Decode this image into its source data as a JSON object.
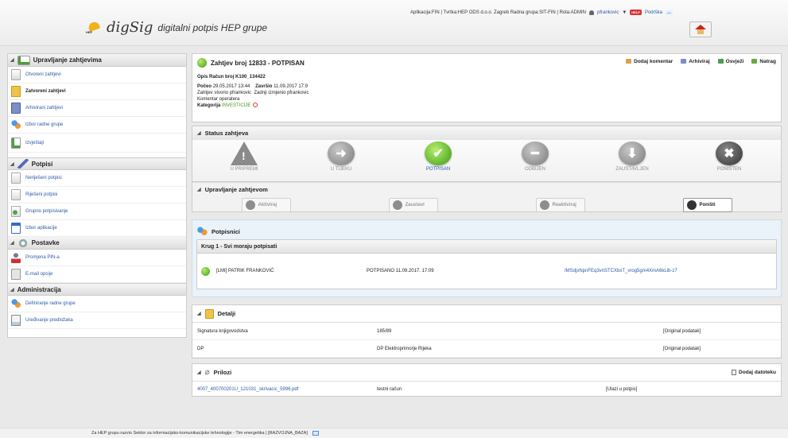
{
  "header": {
    "logo_text": "digSig",
    "logo_mark": "HEP",
    "tagline": "digitalni potpis HEP grupe",
    "info": "Aplikacija:FIN | Tvrtka:HEP ODS d.o.o. Zagreb   Radna grupa:SIT-FIN | Rola:ADMIN",
    "username": "pfrankovic",
    "help_badge": "HELP",
    "support_label": "Podrška",
    "more_label": "..."
  },
  "sidebar": {
    "sections": [
      {
        "title": "Upravljanje zahtjevima",
        "items": [
          {
            "label": "Otvoreni zahtjevi",
            "icon": "document-icon"
          },
          {
            "label": "Zatvoreni zahtjevi",
            "icon": "folder-icon",
            "active": true
          },
          {
            "label": "Arhivirani zahtjevi",
            "icon": "archive-icon"
          },
          {
            "label": "Izbor radne grupe",
            "icon": "users-icon"
          },
          {
            "label": "Izvještaji",
            "icon": "report-icon"
          }
        ]
      },
      {
        "title": "Potpisi",
        "items": [
          {
            "label": "Neriješeni potpisi",
            "icon": "document-icon"
          },
          {
            "label": "Riješeni potpisi",
            "icon": "document-icon"
          },
          {
            "label": "Grupno potpisivanje",
            "icon": "group-sign-icon"
          },
          {
            "label": "Izbor aplikacije",
            "icon": "apps-icon"
          }
        ]
      },
      {
        "title": "Postavke",
        "items": [
          {
            "label": "Promjena PIN-a",
            "icon": "person-icon"
          },
          {
            "label": "E-mail opcije",
            "icon": "mail-icon"
          }
        ]
      },
      {
        "title": "Administracija",
        "items": [
          {
            "label": "Definiranje radne grupe",
            "icon": "users-icon"
          },
          {
            "label": "Uređivanje predložaka",
            "icon": "template-icon"
          }
        ]
      }
    ]
  },
  "request": {
    "title": "Zahtjev broj 12833 - POTPISAN",
    "opis_label": "Opis",
    "opis": "Račun broj K100_134422",
    "poceo_label": "Počeo",
    "poceo": "29.05.2017 13:44",
    "zavrsio_label": "Završio",
    "zavrsio": "11.09.2017 17:9",
    "stvorio_label": "Zahtjev stvorio",
    "stvorio": "pfrankovic",
    "izmjenio_label": "Zadnji izmjenio",
    "izmjenio": "pfrankovic",
    "komentar_label": "Komentar operatera",
    "kategorija_label": "Kategorija",
    "kategorija": "INVESTICIJE",
    "actions": {
      "comment": "Dodaj komentar",
      "archive": "Arhiviraj",
      "refresh": "Osvježi",
      "back": "Natrag"
    }
  },
  "status": {
    "title": "Status zahtjeva",
    "states": [
      {
        "label": "U PRIPREMI",
        "icon": "warning-icon"
      },
      {
        "label": "U TIJEKU",
        "icon": "arrow-right-icon"
      },
      {
        "label": "POTPISAN",
        "icon": "check-icon",
        "active": true
      },
      {
        "label": "ODBIJEN",
        "icon": "minus-icon"
      },
      {
        "label": "ZAUSTAVLJEN",
        "icon": "arrow-down-icon"
      },
      {
        "label": "PONIŠTEN",
        "icon": "x-icon"
      }
    ]
  },
  "control": {
    "title": "Upravljanje zahtjevom",
    "buttons": [
      {
        "label": "Aktiviraj",
        "enabled": false
      },
      {
        "label": "Zaustavi",
        "enabled": false
      },
      {
        "label": "Reaktiviraj",
        "enabled": false
      },
      {
        "label": "Poništi",
        "enabled": true
      }
    ]
  },
  "signers": {
    "title": "Potpisnici",
    "round_title": "Krug 1 - Svi moraju potpisati",
    "rows": [
      {
        "name": "[LMI] PATRIK FRANKOVIĆ",
        "status": "POTPISANO  11.09.2017. 17:09",
        "hash": "IMSdjxNpnFEq3vnSTCXbxT_vrog5gm4XmA6kLib-z7"
      }
    ]
  },
  "details": {
    "title": "Detalji",
    "rows": [
      {
        "name": "Signatura knjigovodstva",
        "value": "185/89",
        "origin": "[Original podatak]"
      },
      {
        "name": "DP",
        "value": "DP Elektroprimorje Rijeka",
        "origin": "[Original podatak]"
      }
    ]
  },
  "attachments": {
    "title": "Prilozi",
    "add_label": "Dodaj datoteku",
    "rows": [
      {
        "file": "4007_400700201U_121031_skrivacic_5996.pdf",
        "desc": "testni račun",
        "sign": "[Ulazi u potpis]"
      }
    ]
  },
  "footer": {
    "text": "Za HEP grupu razvio Sektor za informacijsko-komunikacijske tehnologije - Tim energetika | [RAZVOJNA_BAZA]"
  }
}
